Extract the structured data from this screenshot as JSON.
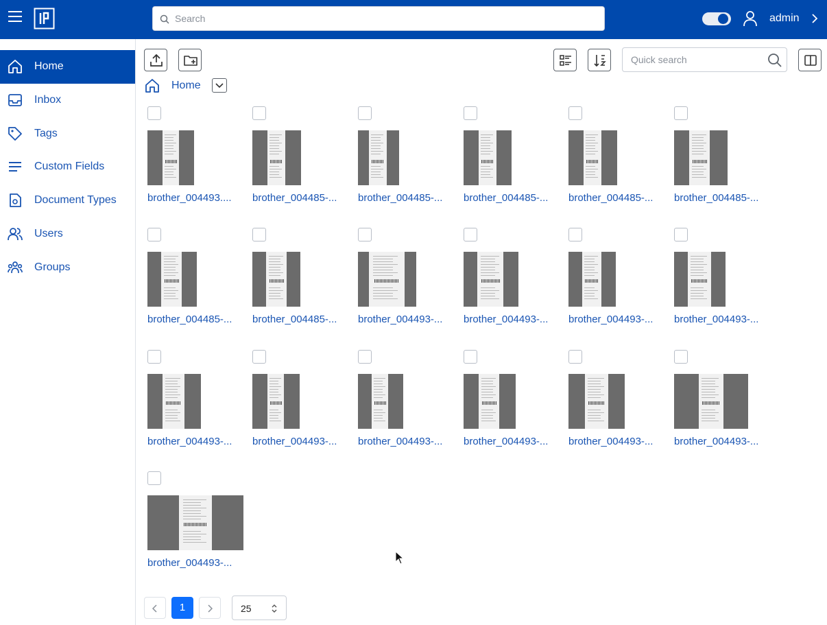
{
  "header": {
    "search_placeholder": "Search",
    "username": "admin",
    "brand_color": "#0049ad"
  },
  "sidebar": {
    "items": [
      {
        "label": "Home",
        "icon": "home-icon",
        "active": true
      },
      {
        "label": "Inbox",
        "icon": "inbox-icon",
        "active": false
      },
      {
        "label": "Tags",
        "icon": "tag-icon",
        "active": false
      },
      {
        "label": "Custom Fields",
        "icon": "list-icon",
        "active": false
      },
      {
        "label": "Document Types",
        "icon": "document-type-icon",
        "active": false
      },
      {
        "label": "Users",
        "icon": "users-icon",
        "active": false
      },
      {
        "label": "Groups",
        "icon": "groups-icon",
        "active": false
      }
    ]
  },
  "toolbar": {
    "quick_search_placeholder": "Quick search",
    "buttons": [
      "upload-icon",
      "new-folder-icon",
      "view-mode-icon",
      "sort-icon",
      "split-view-icon"
    ]
  },
  "breadcrumb": {
    "label": "Home"
  },
  "documents": [
    {
      "name": "brother_004493...."
    },
    {
      "name": "brother_004485-..."
    },
    {
      "name": "brother_004485-..."
    },
    {
      "name": "brother_004485-..."
    },
    {
      "name": "brother_004485-..."
    },
    {
      "name": "brother_004485-..."
    },
    {
      "name": "brother_004485-..."
    },
    {
      "name": "brother_004485-..."
    },
    {
      "name": "brother_004493-..."
    },
    {
      "name": "brother_004493-..."
    },
    {
      "name": "brother_004493-..."
    },
    {
      "name": "brother_004493-..."
    },
    {
      "name": "brother_004493-..."
    },
    {
      "name": "brother_004493-..."
    },
    {
      "name": "brother_004493-..."
    },
    {
      "name": "brother_004493-..."
    },
    {
      "name": "brother_004493-..."
    },
    {
      "name": "brother_004493-..."
    },
    {
      "name": "brother_004493-..."
    }
  ],
  "pagination": {
    "current_page": "1",
    "page_size": "25"
  }
}
